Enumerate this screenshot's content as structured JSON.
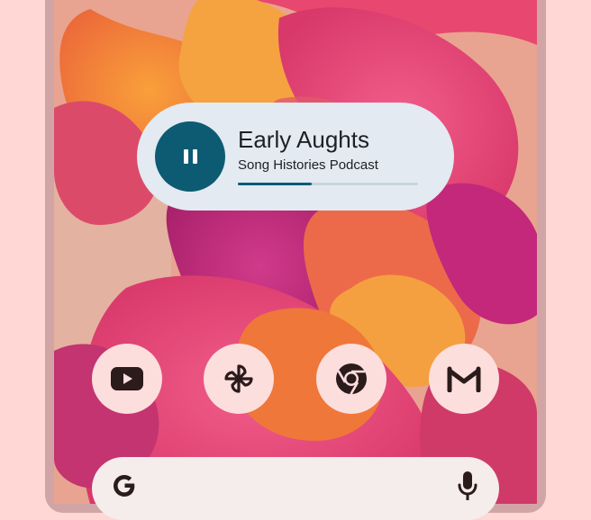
{
  "media_widget": {
    "title": "Early Aughts",
    "subtitle": "Song Histories Podcast",
    "progress_fraction": 0.41,
    "play_state_icon": "pause-icon"
  },
  "dock": {
    "apps": [
      {
        "name": "YouTube",
        "icon": "youtube-icon"
      },
      {
        "name": "Photos",
        "icon": "pinwheel-icon"
      },
      {
        "name": "Chrome",
        "icon": "chrome-icon"
      },
      {
        "name": "Gmail",
        "icon": "gmail-icon"
      }
    ]
  },
  "search_bar": {
    "logo_icon": "google-g-icon",
    "mic_icon": "microphone-icon"
  },
  "colors": {
    "page_background": "#ffd7d5",
    "widget_background": "#e3eaf1",
    "accent": "#0d5b73",
    "app_icon_background": "#fcdedd",
    "icon_foreground": "#2b1b1b"
  }
}
